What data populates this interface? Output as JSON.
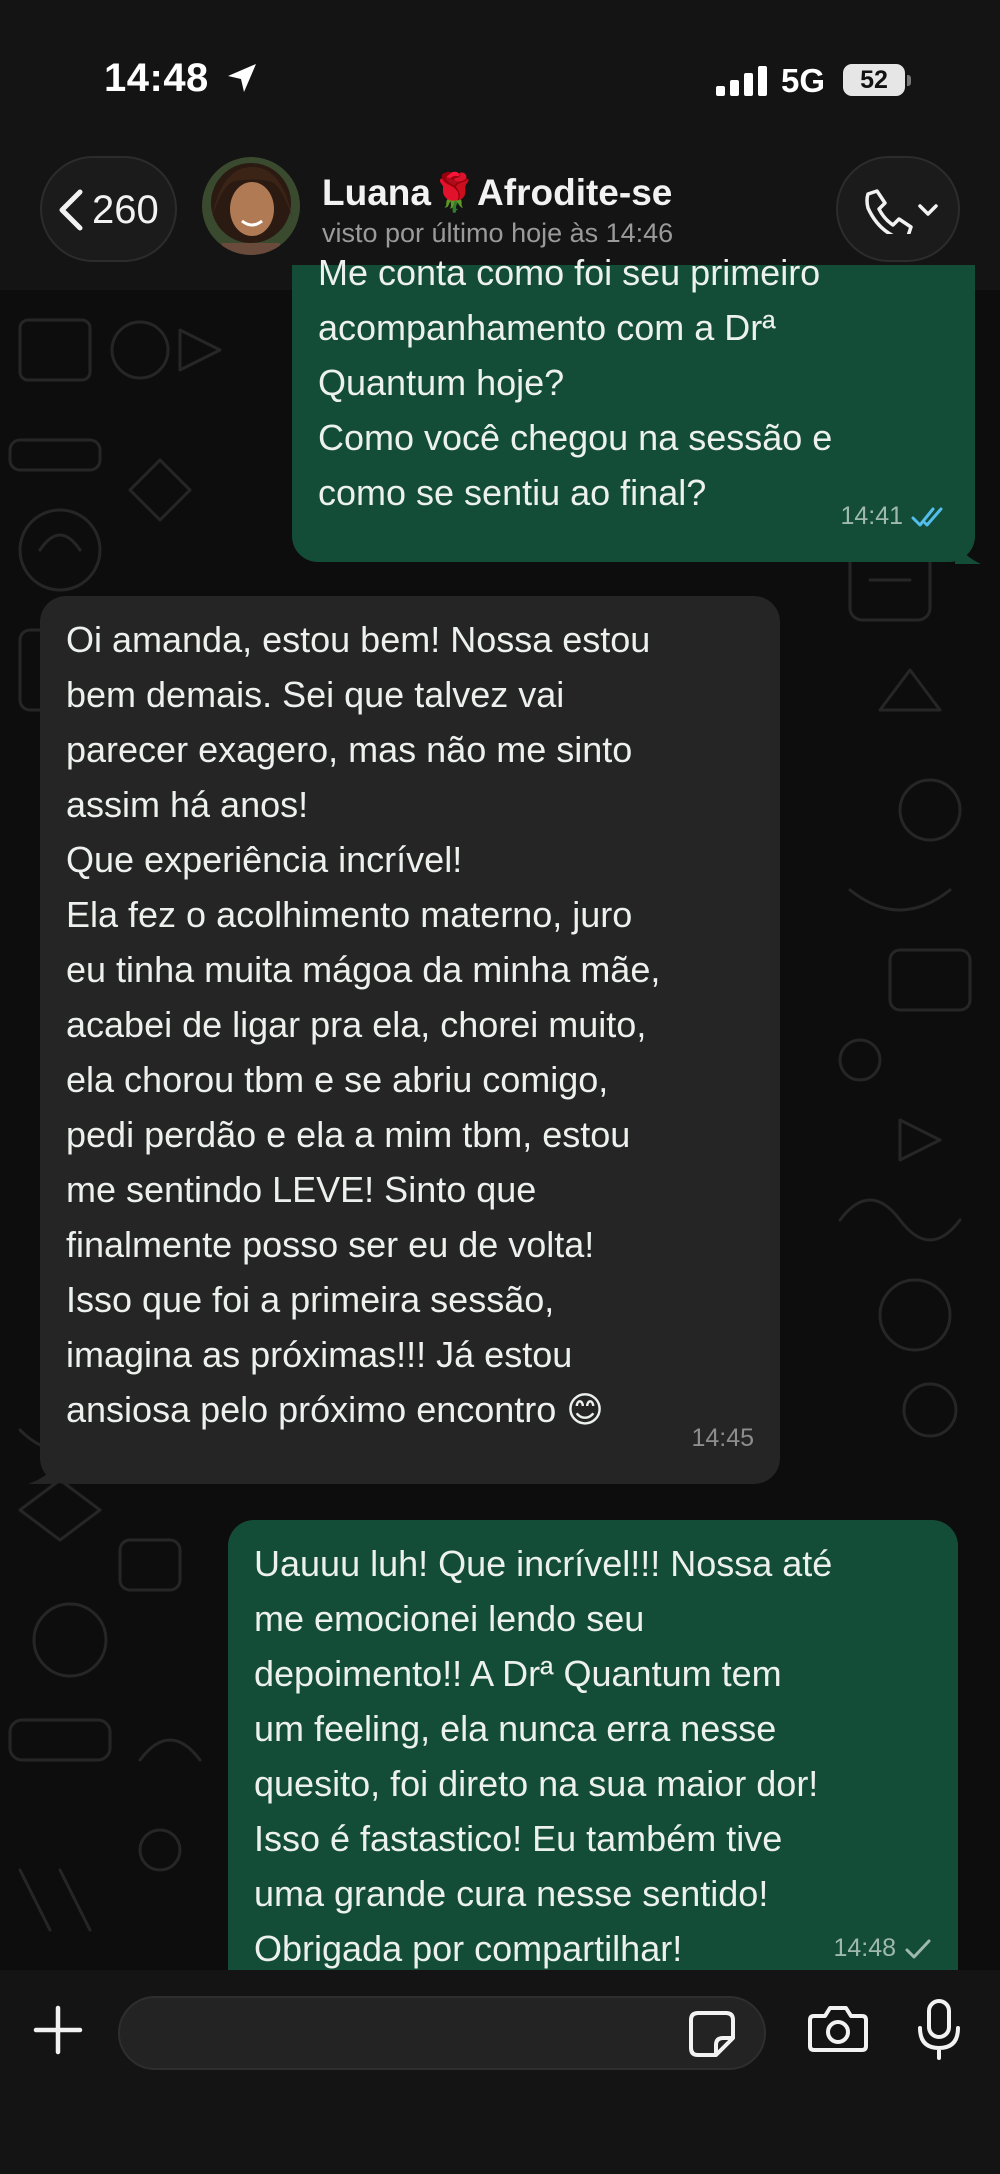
{
  "status_bar": {
    "time": "14:48",
    "network": "5G",
    "battery": "52"
  },
  "header": {
    "back_count": "260",
    "contact_name": "Luana",
    "contact_emoji": "🌹",
    "contact_suffix": "Afrodite-se",
    "last_seen": "visto por último hoje às 14:46"
  },
  "messages": [
    {
      "direction": "out",
      "lines": [
        "Me conta como foi seu primeiro",
        "acompanhamento com a Drª",
        "Quantum hoje?",
        "Como você chegou na sessão e",
        "como se sentiu ao final?"
      ],
      "time": "14:41",
      "status": "read"
    },
    {
      "direction": "in",
      "lines": [
        "Oi amanda, estou bem! Nossa estou",
        "bem demais. Sei que talvez vai",
        "parecer exagero, mas não me sinto",
        "assim há anos!",
        "Que experiência incrível!",
        "Ela fez o acolhimento materno, juro",
        "eu tinha muita mágoa da minha mãe,",
        "acabei de ligar pra ela, chorei muito,",
        "ela chorou tbm e se abriu comigo,",
        "pedi perdão e ela a mim tbm, estou",
        "me sentindo LEVE! Sinto que",
        "finalmente posso ser eu de volta!",
        "Isso que foi a primeira sessão,",
        "imagina as próximas!!! Já estou",
        "ansiosa pelo próximo encontro 😊"
      ],
      "time": "14:45"
    },
    {
      "direction": "out",
      "lines": [
        "Uauuu luh! Que incrível!!! Nossa até",
        "me emocionei lendo seu",
        "depoimento!! A Drª Quantum tem",
        "um feeling, ela nunca erra nesse",
        "quesito, foi direto na sua maior dor!",
        "Isso é fastastico! Eu também tive",
        "uma grande cura nesse sentido!",
        "Obrigada por compartilhar!"
      ],
      "time": "14:48",
      "status": "sent"
    }
  ],
  "input": {
    "placeholder": ""
  },
  "colors": {
    "outgoing": "#144d37",
    "incoming": "#252525",
    "read_ticks": "#53bdeb"
  },
  "icons": [
    "location-arrow-icon",
    "signal-icon",
    "chevron-left-icon",
    "phone-icon",
    "chevron-down-icon",
    "double-check-icon",
    "check-icon",
    "plus-icon",
    "sticker-icon",
    "camera-icon",
    "microphone-icon"
  ]
}
